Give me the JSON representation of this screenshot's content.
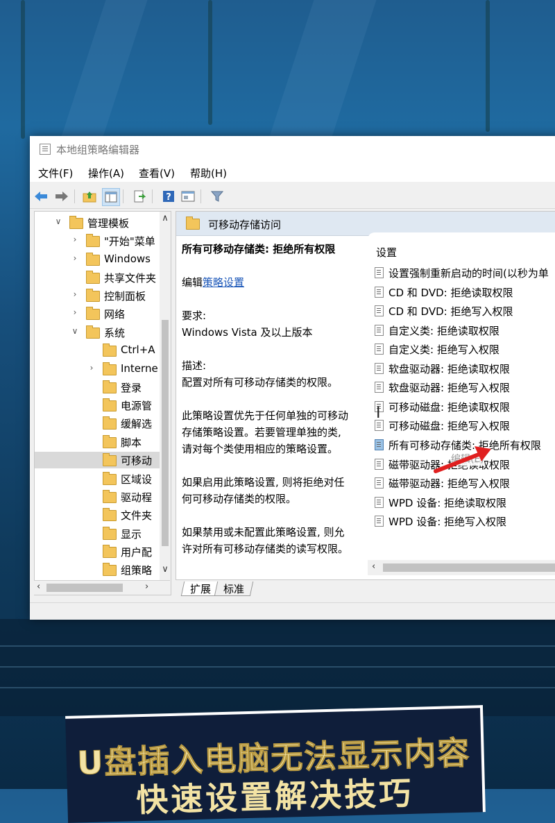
{
  "window": {
    "title": "本地组策略编辑器",
    "menu": [
      "文件(F)",
      "操作(A)",
      "查看(V)",
      "帮助(H)"
    ]
  },
  "toolbar": {
    "icons": [
      "back-arrow-icon",
      "forward-arrow-icon",
      "up-folder-icon",
      "show-hide-tree-icon",
      "export-list-icon",
      "help-icon",
      "properties-icon",
      "filter-icon"
    ]
  },
  "tree": {
    "items": [
      {
        "label": "管理模板",
        "expanded": true
      },
      {
        "label": "\"开始\"菜单"
      },
      {
        "label": "Windows"
      },
      {
        "label": "共享文件夹"
      },
      {
        "label": "控制面板"
      },
      {
        "label": "网络"
      },
      {
        "label": "系统",
        "expanded": true
      },
      {
        "label": "Ctrl+A"
      },
      {
        "label": "Interne"
      },
      {
        "label": "登录"
      },
      {
        "label": "电源管"
      },
      {
        "label": "缓解选"
      },
      {
        "label": "脚本"
      },
      {
        "label": "可移动",
        "selected": true
      },
      {
        "label": "区域设"
      },
      {
        "label": "驱动程"
      },
      {
        "label": "文件夹"
      },
      {
        "label": "显示"
      },
      {
        "label": "用户配"
      },
      {
        "label": "组策略"
      }
    ]
  },
  "right_pane": {
    "header": "可移动存储访问",
    "description": {
      "title": "所有可移动存储类: 拒绝所有权限",
      "edit_prefix": "编辑",
      "edit_link": "策略设置",
      "requirement_label": "要求:",
      "requirement_value": "Windows Vista 及以上版本",
      "desc_label": "描述:",
      "desc_line": "配置对所有可移动存储类的权限。",
      "para1_l1": "此策略设置优先于任何单独的可移动",
      "para1_l2": "存储策略设置。若要管理单独的类,",
      "para1_l3": "请对每个类使用相应的策略设置。",
      "para2_l1": "如果启用此策略设置, 则将拒绝对任",
      "para2_l2": "何可移动存储类的权限。",
      "para3_l1": "如果禁用或未配置此策略设置, 则允",
      "para3_l2": "许对所有可移动存储类的读写权限。"
    },
    "settings_header": "设置",
    "settings": [
      "设置强制重新启动的时间(以秒为单",
      "CD 和 DVD: 拒绝读取权限",
      "CD 和 DVD: 拒绝写入权限",
      "自定义类: 拒绝读取权限",
      "自定义类: 拒绝写入权限",
      "软盘驱动器: 拒绝读取权限",
      "软盘驱动器: 拒绝写入权限",
      "可移动磁盘: 拒绝读取权限",
      "可移动磁盘: 拒绝写入权限",
      "所有可移动存储类: 拒绝所有权限",
      "磁带驱动器: 拒绝读取权限",
      "磁带驱动器: 拒绝写入权限",
      "WPD 设备: 拒绝读取权限",
      "WPD 设备: 拒绝写入权限"
    ],
    "tooltip": "编辑(E)"
  },
  "tabs": [
    "扩展",
    "标准"
  ],
  "banner": {
    "line1": "U盘插入电脑无法显示内容",
    "line2": "快速设置解决技巧"
  },
  "colors": {
    "selection": "#d9d9d9",
    "header_bg": "#dfe8f2",
    "link": "#1a56b8",
    "banner_text": "#f3e3a4",
    "arrow": "#e02020"
  }
}
